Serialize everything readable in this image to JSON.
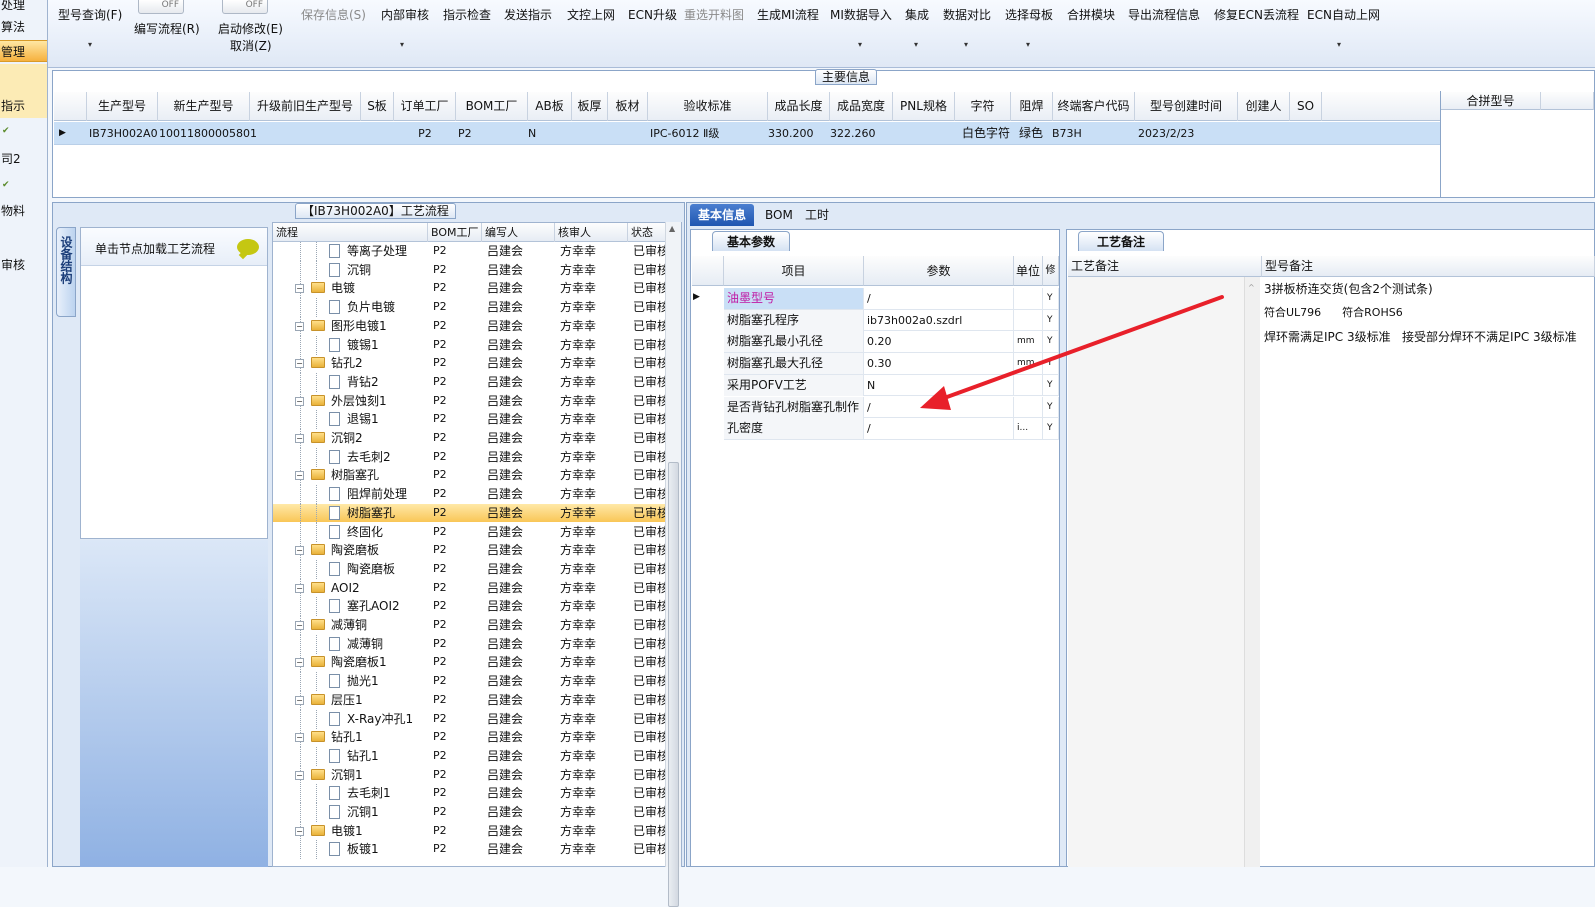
{
  "left_nav": {
    "items": [
      "处理",
      "算法",
      "管理",
      "",
      "指示",
      "",
      "司2",
      "",
      "物料",
      "",
      "审核"
    ]
  },
  "toolbar": {
    "toggle1": "OFF",
    "toggle2": "OFF",
    "items": [
      {
        "label": "型号查询(F)",
        "disabled": false
      },
      {
        "label": "编写流程(R)",
        "disabled": false
      },
      {
        "label": "启动修改(E)",
        "disabled": false
      },
      {
        "label": "取消(Z)",
        "disabled": false
      },
      {
        "label": "保存信息(S)",
        "disabled": true
      },
      {
        "label": "内部审核",
        "disabled": false
      },
      {
        "label": "指示检查",
        "disabled": false
      },
      {
        "label": "发送指示",
        "disabled": false
      },
      {
        "label": "文控上网",
        "disabled": false
      },
      {
        "label": "ECN升级",
        "disabled": false
      },
      {
        "label": "重选开料图",
        "disabled": true
      },
      {
        "label": "生成MI流程",
        "disabled": false
      },
      {
        "label": "MI数据导入",
        "disabled": false
      },
      {
        "label": "集成",
        "disabled": false
      },
      {
        "label": "数据对比",
        "disabled": false
      },
      {
        "label": "选择母板",
        "disabled": false
      },
      {
        "label": "合拼模块",
        "disabled": false
      },
      {
        "label": "导出流程信息",
        "disabled": false
      },
      {
        "label": "修复ECN丢流程",
        "disabled": false
      },
      {
        "label": "ECN自动上网",
        "disabled": false
      }
    ]
  },
  "main_info": {
    "caption": "主要信息",
    "columns": [
      "生产型号",
      "新生产型号",
      "升级前旧生产型号",
      "S板",
      "订单工厂",
      "BOM工厂",
      "AB板",
      "板厚",
      "板材",
      "验收标准",
      "成品长度",
      "成品宽度",
      "PNL规格",
      "字符",
      "阻焊",
      "终端客户代码",
      "型号创建时间",
      "创建人",
      "SO"
    ],
    "row": [
      "IB73H002A0",
      "10011800005801",
      "",
      "",
      "P2",
      "P2",
      "N",
      "",
      "",
      "IPC-6012 Ⅱ级",
      "330.200",
      "322.260",
      "",
      "白色字符",
      "绿色",
      "B73H",
      "2023/2/23",
      "",
      ""
    ],
    "side_columns": [
      "合拼型号",
      ""
    ]
  },
  "process": {
    "caption": "【IB73H002A0】工艺流程",
    "vertical_tab": "设备结构",
    "node_hint": "单击节点加载工艺流程",
    "columns": [
      "流程",
      "BOM工厂",
      "编写人",
      "核审人",
      "状态"
    ],
    "rows": [
      {
        "level": 2,
        "name": "等离子处理",
        "bom": "P2",
        "writer": "吕建会",
        "checker": "方幸幸",
        "status": "已审核",
        "sel": false
      },
      {
        "level": 2,
        "name": "沉铜",
        "bom": "P2",
        "writer": "吕建会",
        "checker": "方幸幸",
        "status": "已审核",
        "sel": false
      },
      {
        "level": 1,
        "name": "电镀",
        "bom": "P2",
        "writer": "吕建会",
        "checker": "方幸幸",
        "status": "已审核",
        "sel": false
      },
      {
        "level": 2,
        "name": "负片电镀",
        "bom": "P2",
        "writer": "吕建会",
        "checker": "方幸幸",
        "status": "已审核",
        "sel": false
      },
      {
        "level": 1,
        "name": "图形电镀1",
        "bom": "P2",
        "writer": "吕建会",
        "checker": "方幸幸",
        "status": "已审核",
        "sel": false
      },
      {
        "level": 2,
        "name": "镀锡1",
        "bom": "P2",
        "writer": "吕建会",
        "checker": "方幸幸",
        "status": "已审核",
        "sel": false
      },
      {
        "level": 1,
        "name": "钻孔2",
        "bom": "P2",
        "writer": "吕建会",
        "checker": "方幸幸",
        "status": "已审核",
        "sel": false
      },
      {
        "level": 2,
        "name": "背钻2",
        "bom": "P2",
        "writer": "吕建会",
        "checker": "方幸幸",
        "status": "已审核",
        "sel": false
      },
      {
        "level": 1,
        "name": "外层蚀刻1",
        "bom": "P2",
        "writer": "吕建会",
        "checker": "方幸幸",
        "status": "已审核",
        "sel": false
      },
      {
        "level": 2,
        "name": "退锡1",
        "bom": "P2",
        "writer": "吕建会",
        "checker": "方幸幸",
        "status": "已审核",
        "sel": false
      },
      {
        "level": 1,
        "name": "沉铜2",
        "bom": "P2",
        "writer": "吕建会",
        "checker": "方幸幸",
        "status": "已审核",
        "sel": false
      },
      {
        "level": 2,
        "name": "去毛刺2",
        "bom": "P2",
        "writer": "吕建会",
        "checker": "方幸幸",
        "status": "已审核",
        "sel": false
      },
      {
        "level": 1,
        "name": "树脂塞孔",
        "bom": "P2",
        "writer": "吕建会",
        "checker": "方幸幸",
        "status": "已审核",
        "sel": false
      },
      {
        "level": 2,
        "name": "阻焊前处理",
        "bom": "P2",
        "writer": "吕建会",
        "checker": "方幸幸",
        "status": "已审核",
        "sel": false
      },
      {
        "level": 2,
        "name": "树脂塞孔",
        "bom": "P2",
        "writer": "吕建会",
        "checker": "方幸幸",
        "status": "已审核",
        "sel": true
      },
      {
        "level": 2,
        "name": "终固化",
        "bom": "P2",
        "writer": "吕建会",
        "checker": "方幸幸",
        "status": "已审核",
        "sel": false
      },
      {
        "level": 1,
        "name": "陶瓷磨板",
        "bom": "P2",
        "writer": "吕建会",
        "checker": "方幸幸",
        "status": "已审核",
        "sel": false
      },
      {
        "level": 2,
        "name": "陶瓷磨板",
        "bom": "P2",
        "writer": "吕建会",
        "checker": "方幸幸",
        "status": "已审核",
        "sel": false
      },
      {
        "level": 1,
        "name": "AOI2",
        "bom": "P2",
        "writer": "吕建会",
        "checker": "方幸幸",
        "status": "已审核",
        "sel": false
      },
      {
        "level": 2,
        "name": "塞孔AOI2",
        "bom": "P2",
        "writer": "吕建会",
        "checker": "方幸幸",
        "status": "已审核",
        "sel": false
      },
      {
        "level": 1,
        "name": "减薄铜",
        "bom": "P2",
        "writer": "吕建会",
        "checker": "方幸幸",
        "status": "已审核",
        "sel": false
      },
      {
        "level": 2,
        "name": "减薄铜",
        "bom": "P2",
        "writer": "吕建会",
        "checker": "方幸幸",
        "status": "已审核",
        "sel": false
      },
      {
        "level": 1,
        "name": "陶瓷磨板1",
        "bom": "P2",
        "writer": "吕建会",
        "checker": "方幸幸",
        "status": "已审核",
        "sel": false
      },
      {
        "level": 2,
        "name": "抛光1",
        "bom": "P2",
        "writer": "吕建会",
        "checker": "方幸幸",
        "status": "已审核",
        "sel": false
      },
      {
        "level": 1,
        "name": "层压1",
        "bom": "P2",
        "writer": "吕建会",
        "checker": "方幸幸",
        "status": "已审核",
        "sel": false
      },
      {
        "level": 2,
        "name": "X-Ray冲孔1",
        "bom": "P2",
        "writer": "吕建会",
        "checker": "方幸幸",
        "status": "已审核",
        "sel": false
      },
      {
        "level": 1,
        "name": "钻孔1",
        "bom": "P2",
        "writer": "吕建会",
        "checker": "方幸幸",
        "status": "已审核",
        "sel": false
      },
      {
        "level": 2,
        "name": "钻孔1",
        "bom": "P2",
        "writer": "吕建会",
        "checker": "方幸幸",
        "status": "已审核",
        "sel": false
      },
      {
        "level": 1,
        "name": "沉铜1",
        "bom": "P2",
        "writer": "吕建会",
        "checker": "方幸幸",
        "status": "已审核",
        "sel": false
      },
      {
        "level": 2,
        "name": "去毛刺1",
        "bom": "P2",
        "writer": "吕建会",
        "checker": "方幸幸",
        "status": "已审核",
        "sel": false
      },
      {
        "level": 2,
        "name": "沉铜1",
        "bom": "P2",
        "writer": "吕建会",
        "checker": "方幸幸",
        "status": "已审核",
        "sel": false
      },
      {
        "level": 1,
        "name": "电镀1",
        "bom": "P2",
        "writer": "吕建会",
        "checker": "方幸幸",
        "status": "已审核",
        "sel": false
      },
      {
        "level": 2,
        "name": "板镀1",
        "bom": "P2",
        "writer": "吕建会",
        "checker": "方幸幸",
        "status": "已审核",
        "sel": false
      }
    ]
  },
  "right_tabs": [
    "基本信息",
    "BOM",
    "工时"
  ],
  "basic_params": {
    "tab": "基本参数",
    "columns": [
      "项目",
      "参数",
      "单位",
      "修"
    ],
    "rows": [
      {
        "item": "油墨型号",
        "value": "/",
        "unit": "",
        "mod": "Y",
        "highlight": true
      },
      {
        "item": "树脂塞孔程序",
        "value": "ib73h002a0.szdrl",
        "unit": "",
        "mod": "Y",
        "highlight": false
      },
      {
        "item": "树脂塞孔最小孔径",
        "value": "0.20",
        "unit": "mm",
        "mod": "Y",
        "highlight": false
      },
      {
        "item": "树脂塞孔最大孔径",
        "value": "0.30",
        "unit": "mm",
        "mod": "Y",
        "highlight": false
      },
      {
        "item": "采用POFV工艺",
        "value": "N",
        "unit": "",
        "mod": "Y",
        "highlight": false
      },
      {
        "item": "是否背钻孔树脂塞孔制作",
        "value": "/",
        "unit": "",
        "mod": "Y",
        "highlight": false
      },
      {
        "item": "孔密度",
        "value": "/",
        "unit": "i...",
        "mod": "Y",
        "highlight": false
      }
    ]
  },
  "remarks": {
    "tab": "工艺备注",
    "col_process": "工艺备注",
    "col_model": "型号备注",
    "lines": [
      "3拼板桥连交货(包含2个测试条)",
      "符合UL796      符合ROHS6",
      "焊环需满足IPC 3级标准   接受部分焊环不满足IPC 3级标准"
    ]
  },
  "colors": {
    "accent": "#1f56b0",
    "selection": "#f9c657",
    "arrow": "#e8202a"
  }
}
